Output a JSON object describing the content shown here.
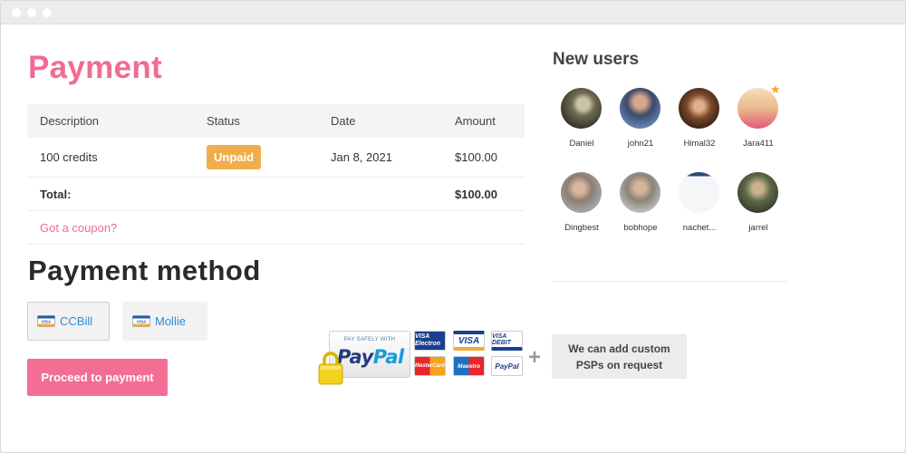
{
  "page_title": "Payment",
  "table": {
    "headers": [
      "Description",
      "Status",
      "Date",
      "Amount"
    ],
    "item": {
      "description": "100 credits",
      "status": "Unpaid",
      "date": "Jan 8, 2021",
      "amount": "$100.00"
    },
    "total_label": "Total:",
    "total_amount": "$100.00",
    "coupon_link": "Got a coupon?"
  },
  "payment_method": {
    "title": "Payment method",
    "options": [
      {
        "label": "CCBill",
        "icon": "card-icon",
        "selected": true
      },
      {
        "label": "Mollie",
        "icon": "card-icon",
        "selected": false
      }
    ],
    "proceed_label": "Proceed to payment"
  },
  "psp": {
    "paypal_safe": "PAY SAFELY WITH",
    "paypal_a": "Pay",
    "paypal_b": "Pal",
    "card_logos": [
      "VISA Electron",
      "VISA",
      "VISA DEBIT",
      "MasterCard",
      "Maestro",
      "PayPal"
    ],
    "plus": "+",
    "custom_text": "We can add custom PSPs on request"
  },
  "new_users": {
    "title": "New users",
    "users": [
      {
        "name": "Daniel"
      },
      {
        "name": "john21"
      },
      {
        "name": "Himal32"
      },
      {
        "name": "Jara411",
        "featured": true
      },
      {
        "name": "Dingbest"
      },
      {
        "name": "bobhope"
      },
      {
        "name": "nachet..."
      },
      {
        "name": "jarrel"
      }
    ]
  },
  "colors": {
    "accent": "#f06c92",
    "button": "#f26e95",
    "unpaid_badge": "#efae4b",
    "link_blue": "#2f8bd6"
  }
}
